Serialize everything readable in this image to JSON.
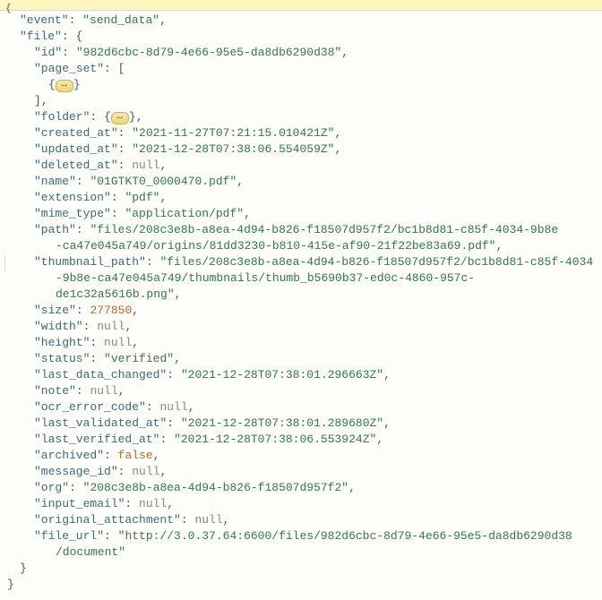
{
  "top": {
    "open_brace": "{"
  },
  "json": {
    "event": {
      "key": "\"event\"",
      "value": "\"send_data\""
    },
    "file": {
      "key": "\"file\""
    },
    "id": {
      "key": "\"id\"",
      "value": "\"982d6cbc-8d79-4e66-95e5-da8db6290d38\""
    },
    "page_set": {
      "key": "\"page_set\""
    },
    "page_set_item_open": "{",
    "page_set_item_close": "}",
    "collapsed_ellipsis": "↔",
    "folder": {
      "key": "\"folder\"",
      "open": "{",
      "close": "}"
    },
    "created_at": {
      "key": "\"created_at\"",
      "value": "\"2021-11-27T07:21:15.010421Z\""
    },
    "updated_at": {
      "key": "\"updated_at\"",
      "value": "\"2021-12-28T07:38:06.554059Z\""
    },
    "deleted_at": {
      "key": "\"deleted_at\"",
      "value": "null"
    },
    "name": {
      "key": "\"name\"",
      "value": "\"01GTKT0_0000470.pdf\""
    },
    "extension": {
      "key": "\"extension\"",
      "value": "\"pdf\""
    },
    "mime_type": {
      "key": "\"mime_type\"",
      "value": "\"application/pdf\""
    },
    "path": {
      "key": "\"path\"",
      "value1": "\"files/208c3e8b-a8ea-4d94-b826-f18507d957f2/bc1b8d81-c85f-4034-9b8e",
      "value2": "-ca47e045a749/origins/81dd3230-b810-415e-af90-21f22be83a69.pdf\""
    },
    "thumbnail_path": {
      "key": "\"thumbnail_path\"",
      "value1": "\"files/208c3e8b-a8ea-4d94-b826-f18507d957f2/bc1b8d81-c85f-4034",
      "value2": "-9b8e-ca47e045a749/thumbnails/thumb_b5690b37-ed0c-4860-957c-de1c32a5616b.png\""
    },
    "size": {
      "key": "\"size\"",
      "value": "277850"
    },
    "width": {
      "key": "\"width\"",
      "value": "null"
    },
    "height": {
      "key": "\"height\"",
      "value": "null"
    },
    "status": {
      "key": "\"status\"",
      "value": "\"verified\""
    },
    "last_data_changed": {
      "key": "\"last_data_changed\"",
      "value": "\"2021-12-28T07:38:01.296663Z\""
    },
    "note": {
      "key": "\"note\"",
      "value": "null"
    },
    "ocr_error_code": {
      "key": "\"ocr_error_code\"",
      "value": "null"
    },
    "last_validated_at": {
      "key": "\"last_validated_at\"",
      "value": "\"2021-12-28T07:38:01.289680Z\""
    },
    "last_verified_at": {
      "key": "\"last_verified_at\"",
      "value": "\"2021-12-28T07:38:06.553924Z\""
    },
    "archived": {
      "key": "\"archived\"",
      "value": "false"
    },
    "message_id": {
      "key": "\"message_id\"",
      "value": "null"
    },
    "org": {
      "key": "\"org\"",
      "value": "\"208c3e8b-a8ea-4d94-b826-f18507d957f2\""
    },
    "input_email": {
      "key": "\"input_email\"",
      "value": "null"
    },
    "original_attachment": {
      "key": "\"original_attachment\"",
      "value": "null"
    },
    "file_url": {
      "key": "\"file_url\"",
      "value1": "\"http://3.0.37.64:6600/files/982d6cbc-8d79-4e66-95e5-da8db6290d38",
      "value2": "/document\""
    }
  },
  "punc": {
    "colon": ":",
    "comma": ",",
    "open_brace": "{",
    "close_brace": "}",
    "open_bracket": "[",
    "close_bracket": "]"
  }
}
